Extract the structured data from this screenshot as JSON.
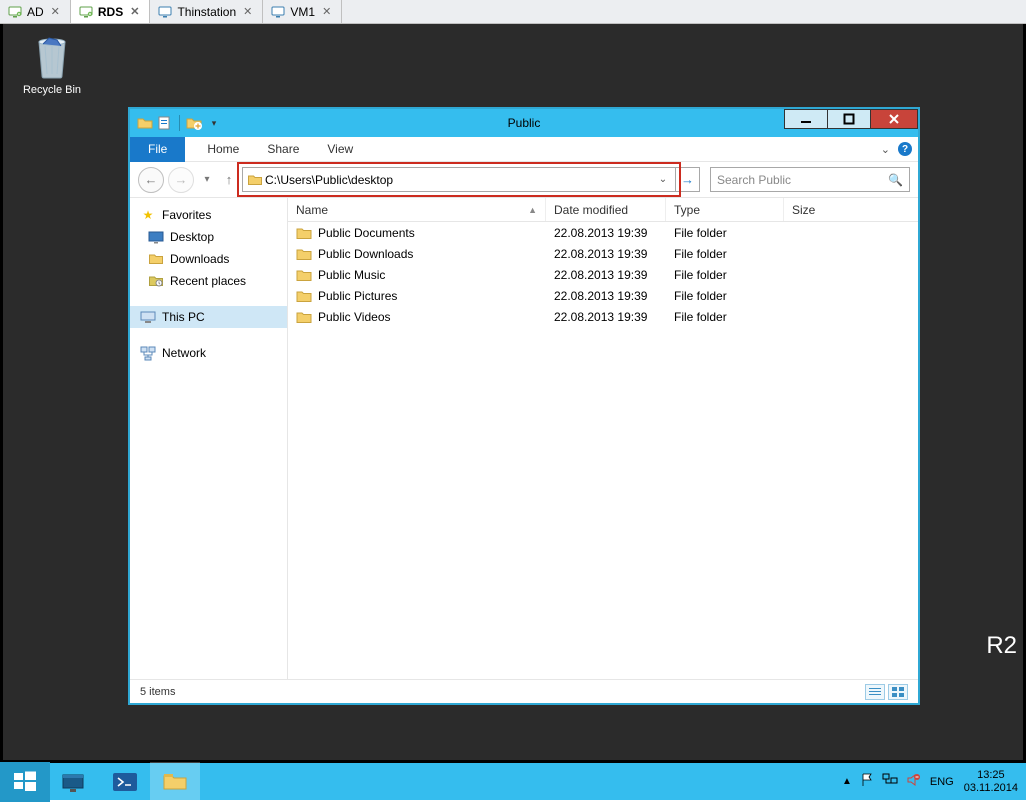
{
  "vm_tabs": [
    {
      "label": "AD",
      "active": false
    },
    {
      "label": "RDS",
      "active": true
    },
    {
      "label": "Thinstation",
      "active": false
    },
    {
      "label": "VM1",
      "active": false
    }
  ],
  "desktop": {
    "recycle_bin": "Recycle Bin",
    "watermark": "R2"
  },
  "explorer": {
    "title": "Public",
    "ribbon": {
      "file": "File",
      "tabs": [
        "Home",
        "Share",
        "View"
      ]
    },
    "address": "C:\\Users\\Public\\desktop",
    "search_placeholder": "Search Public",
    "sidebar": {
      "favorites": {
        "label": "Favorites",
        "items": [
          "Desktop",
          "Downloads",
          "Recent places"
        ]
      },
      "thispc": {
        "label": "This PC"
      },
      "network": {
        "label": "Network"
      }
    },
    "columns": [
      "Name",
      "Date modified",
      "Type",
      "Size"
    ],
    "rows": [
      {
        "name": "Public Documents",
        "date": "22.08.2013 19:39",
        "type": "File folder",
        "size": ""
      },
      {
        "name": "Public Downloads",
        "date": "22.08.2013 19:39",
        "type": "File folder",
        "size": ""
      },
      {
        "name": "Public Music",
        "date": "22.08.2013 19:39",
        "type": "File folder",
        "size": ""
      },
      {
        "name": "Public Pictures",
        "date": "22.08.2013 19:39",
        "type": "File folder",
        "size": ""
      },
      {
        "name": "Public Videos",
        "date": "22.08.2013 19:39",
        "type": "File folder",
        "size": ""
      }
    ],
    "status": "5 items"
  },
  "taskbar": {
    "lang": "ENG",
    "time": "13:25",
    "date": "03.11.2014"
  }
}
